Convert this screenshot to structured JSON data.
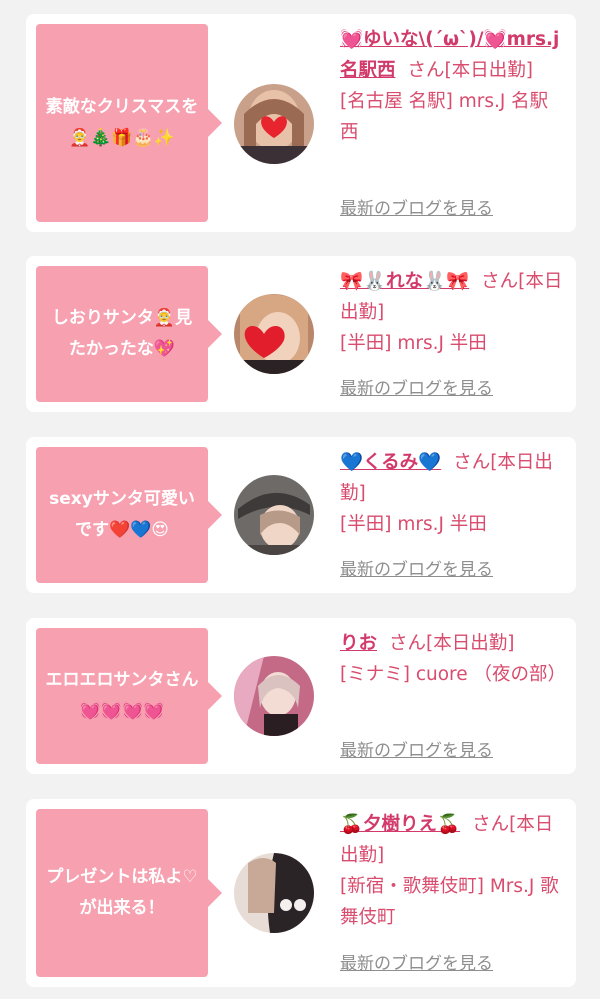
{
  "colors": {
    "bubble_bg": "#f6a0b0",
    "accent_name": "#d23a6b",
    "info_text": "#d94c6e",
    "link_gray": "#8e8e8e",
    "page_bg": "#f2f2f2"
  },
  "cards": [
    {
      "comment": "素敵なクリスマスを🤶🎄🎁🎂✨",
      "name": "💓ゆいな\\(´ω`)/💓mrs.j名駅西",
      "suffix": "さん[本日出勤]",
      "shop": "[名古屋 名駅] mrs.J 名駅西",
      "blog_link": "最新のブログを見る"
    },
    {
      "comment": "しおりサンタ🤶見たかったな💖",
      "name": "🎀🐰れな🐰🎀",
      "suffix": "さん[本日出勤]",
      "shop": "[半田] mrs.J 半田",
      "blog_link": "最新のブログを見る"
    },
    {
      "comment": "sexyサンタ可愛いです❤️💙😍",
      "name": "💙くるみ💙",
      "suffix": "さん[本日出勤]",
      "shop": "[半田] mrs.J 半田",
      "blog_link": "最新のブログを見る"
    },
    {
      "comment": "エロエロサンタさん💓💓💓💓",
      "name": "りお",
      "suffix": "さん[本日出勤]",
      "shop": "[ミナミ] cuore （夜の部）",
      "blog_link": "最新のブログを見る"
    },
    {
      "comment": "プレゼントは私よ♡が出来る！",
      "name": "🍒夕樹りえ🍒",
      "suffix": "さん[本日出勤]",
      "shop": "[新宿・歌舞伎町] Mrs.J 歌舞伎町",
      "blog_link": "最新のブログを見る"
    }
  ]
}
